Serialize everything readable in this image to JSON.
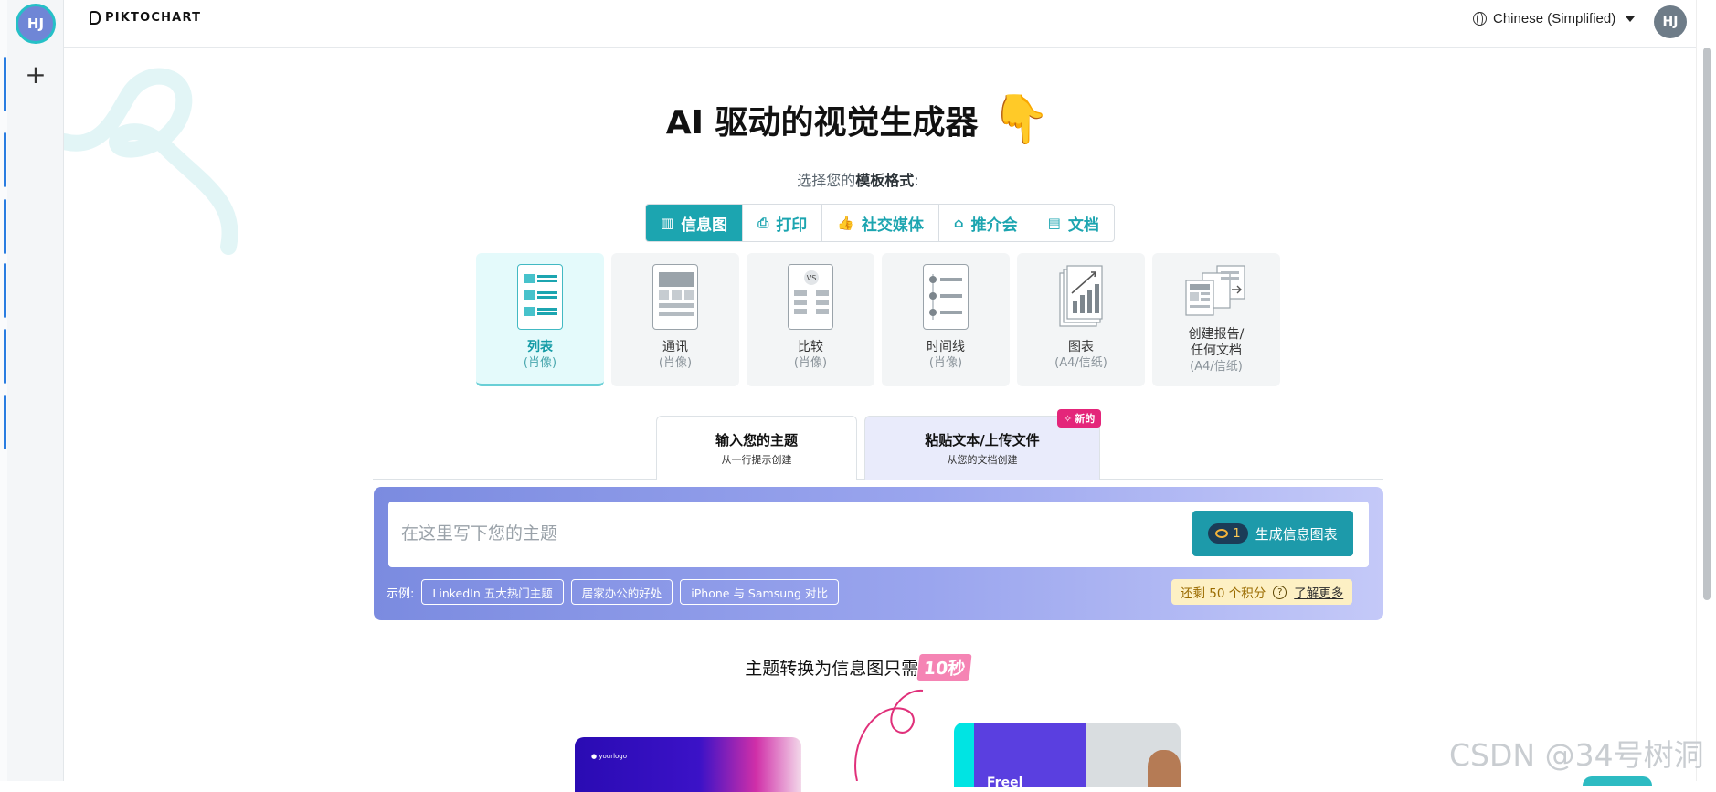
{
  "rail": {
    "avatar_initials": "HJ",
    "add_symbol": "+"
  },
  "header": {
    "logo_text": "PIKTOCHART",
    "language": "Chinese (Simplified)",
    "avatar_initials": "HJ"
  },
  "hero": {
    "title": "AI 驱动的视觉生成器",
    "hand_emoji": "👇",
    "subtitle_prefix": "选择您的",
    "subtitle_bold": "模板格式",
    "subtitle_suffix": ":"
  },
  "format_tabs": [
    {
      "label": "信息图",
      "icon": "infographic-icon",
      "active": true
    },
    {
      "label": "打印",
      "icon": "print-icon",
      "active": false
    },
    {
      "label": "社交媒体",
      "icon": "thumbs-up-icon",
      "active": false
    },
    {
      "label": "推介会",
      "icon": "presentation-icon",
      "active": false
    },
    {
      "label": "文档",
      "icon": "document-icon",
      "active": false
    }
  ],
  "template_cards": [
    {
      "label": "列表",
      "sub": "(肖像)",
      "active": true
    },
    {
      "label": "通讯",
      "sub": "(肖像)",
      "active": false
    },
    {
      "label": "比较",
      "sub": "(肖像)",
      "active": false
    },
    {
      "label": "时间线",
      "sub": "(肖像)",
      "active": false
    },
    {
      "label": "图表",
      "sub": "(A4/信纸)",
      "active": false
    },
    {
      "label": "创建报告/\n任何文档",
      "label_line1": "创建报告/",
      "label_line2": "任何文档",
      "sub": "(A4/信纸)",
      "active": false
    }
  ],
  "compare_badge": "VS",
  "mode_tabs": {
    "topic": {
      "title": "输入您的主题",
      "sub": "从一行提示创建"
    },
    "paste": {
      "title": "粘贴文本/上传文件",
      "sub": "从您的文档创建"
    },
    "new_badge": "新的"
  },
  "input": {
    "placeholder": "在这里写下您的主题",
    "value": "",
    "credit_cost": "1",
    "generate_label": "生成信息图表"
  },
  "examples": {
    "label": "示例:",
    "chips": [
      "LinkedIn 五大热门主题",
      "居家办公的好处",
      "iPhone 与 Samsung 对比"
    ]
  },
  "credits": {
    "remaining_text": "还剩 50 个积分",
    "help_symbol": "?",
    "learn_more": "了解更多"
  },
  "tagline": {
    "prefix": "主题转换为信息图只需",
    "highlight": "10秒"
  },
  "previews": {
    "logo_text": "yourlogo",
    "second_text": "Freel"
  },
  "watermark": "CSDN @34号树洞",
  "colors": {
    "accent": "#1ca5b0",
    "badge": "#e4257a",
    "highlight": "#f584b4"
  }
}
